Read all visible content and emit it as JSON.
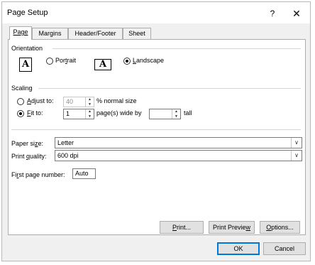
{
  "window": {
    "title": "Page Setup",
    "help": "?",
    "close": "✕"
  },
  "tabs": [
    {
      "label": "Page"
    },
    {
      "label": "Margins"
    },
    {
      "label": "Header/Footer"
    },
    {
      "label": "Sheet"
    }
  ],
  "orientation": {
    "heading": "Orientation",
    "portrait_icon": "A",
    "portrait_label": "Portrait",
    "landscape_icon": "A",
    "landscape_label": "Landscape",
    "selected": "landscape"
  },
  "scaling": {
    "heading": "Scaling",
    "adjust_label": "Adjust to:",
    "adjust_value": "40",
    "adjust_suffix": "% normal size",
    "fit_label": "Fit to:",
    "fit_wide_value": "1",
    "fit_wide_suffix": "page(s) wide by",
    "fit_tall_value": "",
    "fit_tall_suffix": "tall",
    "selected": "fit"
  },
  "paper": {
    "label": "Paper size:",
    "value": "Letter"
  },
  "print_quality": {
    "label": "Print quality:",
    "value": "600 dpi"
  },
  "first_page": {
    "label": "First page number:",
    "value": "Auto"
  },
  "buttons": {
    "print": "Print...",
    "print_preview": "Print Preview",
    "options": "Options...",
    "ok": "OK",
    "cancel": "Cancel"
  },
  "colors": {
    "accent": "#0078d7",
    "dialog_bg": "#f0f0f0",
    "panel_bg": "#ffffff"
  }
}
